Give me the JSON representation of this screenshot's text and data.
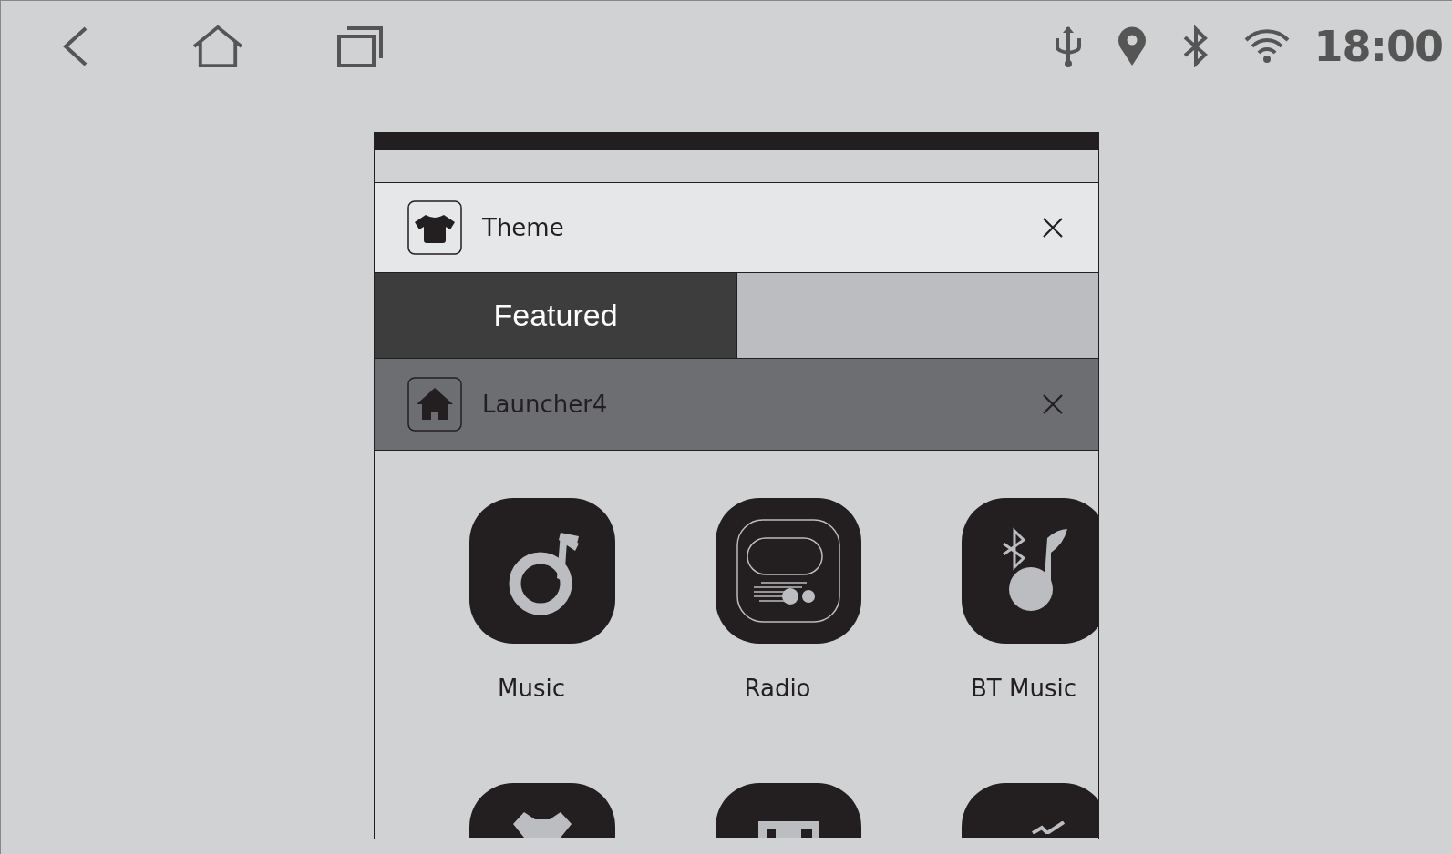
{
  "status_bar": {
    "time": "18:00"
  },
  "dialogs": [
    {
      "title": "Theme",
      "kind": "shirt",
      "selected": false
    },
    {
      "title": "Launcher4",
      "kind": "home",
      "selected": true
    }
  ],
  "tabs": [
    {
      "label": "Featured",
      "selected": true
    },
    {
      "selected": false
    }
  ],
  "apps": [
    {
      "label": "Music",
      "kind": "music"
    },
    {
      "label": "Radio",
      "kind": "radio"
    },
    {
      "label": "BT Music",
      "kind": "bt-music"
    },
    {
      "kind": "shirt"
    },
    {
      "kind": "cassette"
    },
    {
      "kind": "check"
    }
  ]
}
